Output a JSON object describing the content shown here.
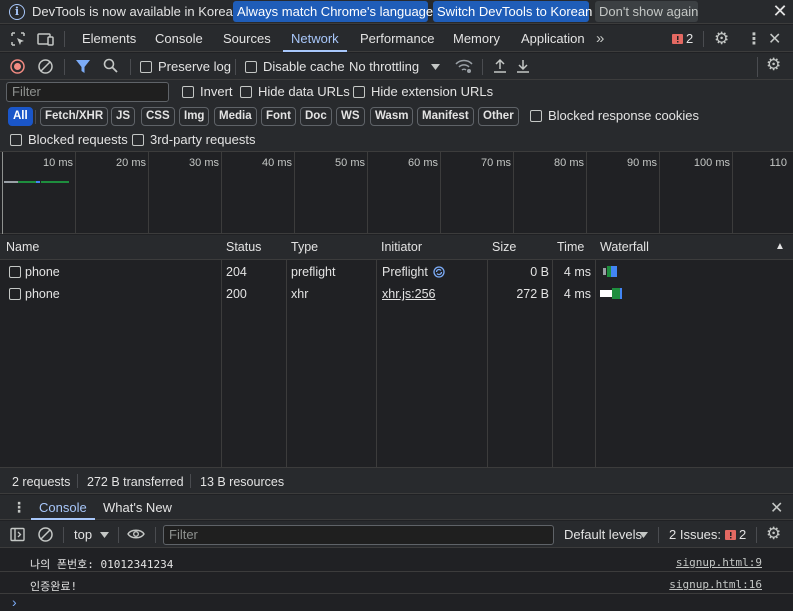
{
  "infobar": {
    "message": "DevTools is now available in Korean!",
    "match_language_button": "Always match Chrome's language",
    "switch_language_button": "Switch DevTools to Korean",
    "dont_show_button": "Don't show again",
    "close_icon": "✕"
  },
  "main_tabs": [
    "Elements",
    "Console",
    "Sources",
    "Network",
    "Performance",
    "Memory",
    "Application"
  ],
  "active_tab": "Network",
  "issues_badge_count": "2",
  "network_toolbar": {
    "preserve_log": "Preserve log",
    "disable_cache": "Disable cache",
    "throttling": "No throttling"
  },
  "filter": {
    "placeholder": "Filter",
    "invert": "Invert",
    "hide_data_urls": "Hide data URLs",
    "hide_extension_urls": "Hide extension URLs"
  },
  "type_filters": [
    "All",
    "Fetch/XHR",
    "JS",
    "CSS",
    "Img",
    "Media",
    "Font",
    "Doc",
    "WS",
    "Wasm",
    "Manifest",
    "Other"
  ],
  "active_type_filter": "All",
  "blocked_response_cookies": "Blocked response cookies",
  "blocked_requests": "Blocked requests",
  "third_party_requests": "3rd-party requests",
  "timeline_ticks": [
    "10 ms",
    "20 ms",
    "30 ms",
    "40 ms",
    "50 ms",
    "60 ms",
    "70 ms",
    "80 ms",
    "90 ms",
    "100 ms",
    "110"
  ],
  "table": {
    "columns": [
      "Name",
      "Status",
      "Type",
      "Initiator",
      "Size",
      "Time",
      "Waterfall"
    ],
    "sort_indicator": "▲",
    "rows": [
      {
        "name": "phone",
        "status": "204",
        "type": "preflight",
        "initiator": "Preflight",
        "size": "0 B",
        "time": "4 ms"
      },
      {
        "name": "phone",
        "status": "200",
        "type": "xhr",
        "initiator": "xhr.js:256",
        "size": "272 B",
        "time": "4 ms"
      }
    ]
  },
  "status_bar": {
    "requests": "2 requests",
    "transferred": "272 B transferred",
    "resources": "13 B resources"
  },
  "drawer": {
    "tabs": [
      "Console",
      "What's New"
    ],
    "active_tab": "Console",
    "context": "top",
    "filter_placeholder": "Filter",
    "levels": "Default levels",
    "issues_label": "2 Issues:",
    "issues_count": "2"
  },
  "console_logs": [
    {
      "message": "나의 폰번호: 01012341234",
      "source": "signup.html:9"
    },
    {
      "message": "인증완료!",
      "source": "signup.html:16"
    }
  ],
  "prompt_symbol": "›",
  "colors": {
    "accent": "#a8c7fa",
    "record_red": "#f28b82",
    "issue_red": "#e46962",
    "filter_blue": "#7cacf8",
    "waterfall_green": "#1e8e3e",
    "waterfall_blue": "#4285f4"
  }
}
